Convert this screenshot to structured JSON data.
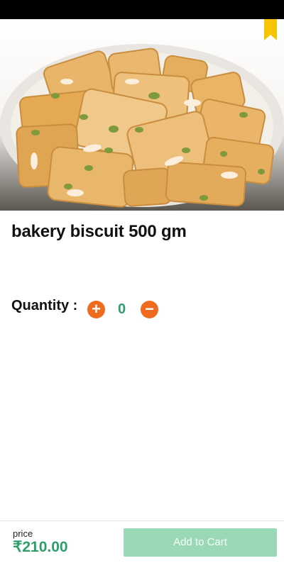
{
  "product": {
    "title": "bakery biscuit 500 gm",
    "image_icon": "biscuit-image"
  },
  "quantity": {
    "label": "Quantity :",
    "value": "0",
    "plus_symbol": "+",
    "minus_symbol": "−"
  },
  "footer": {
    "price_label": "price",
    "price_value": "₹210.00",
    "add_to_cart_label": "Add to Cart"
  },
  "colors": {
    "accent_orange": "#ef6b1e",
    "accent_green": "#2e9f6a",
    "button_green_disabled": "#9bd8b6",
    "bookmark_yellow": "#f6c400"
  }
}
